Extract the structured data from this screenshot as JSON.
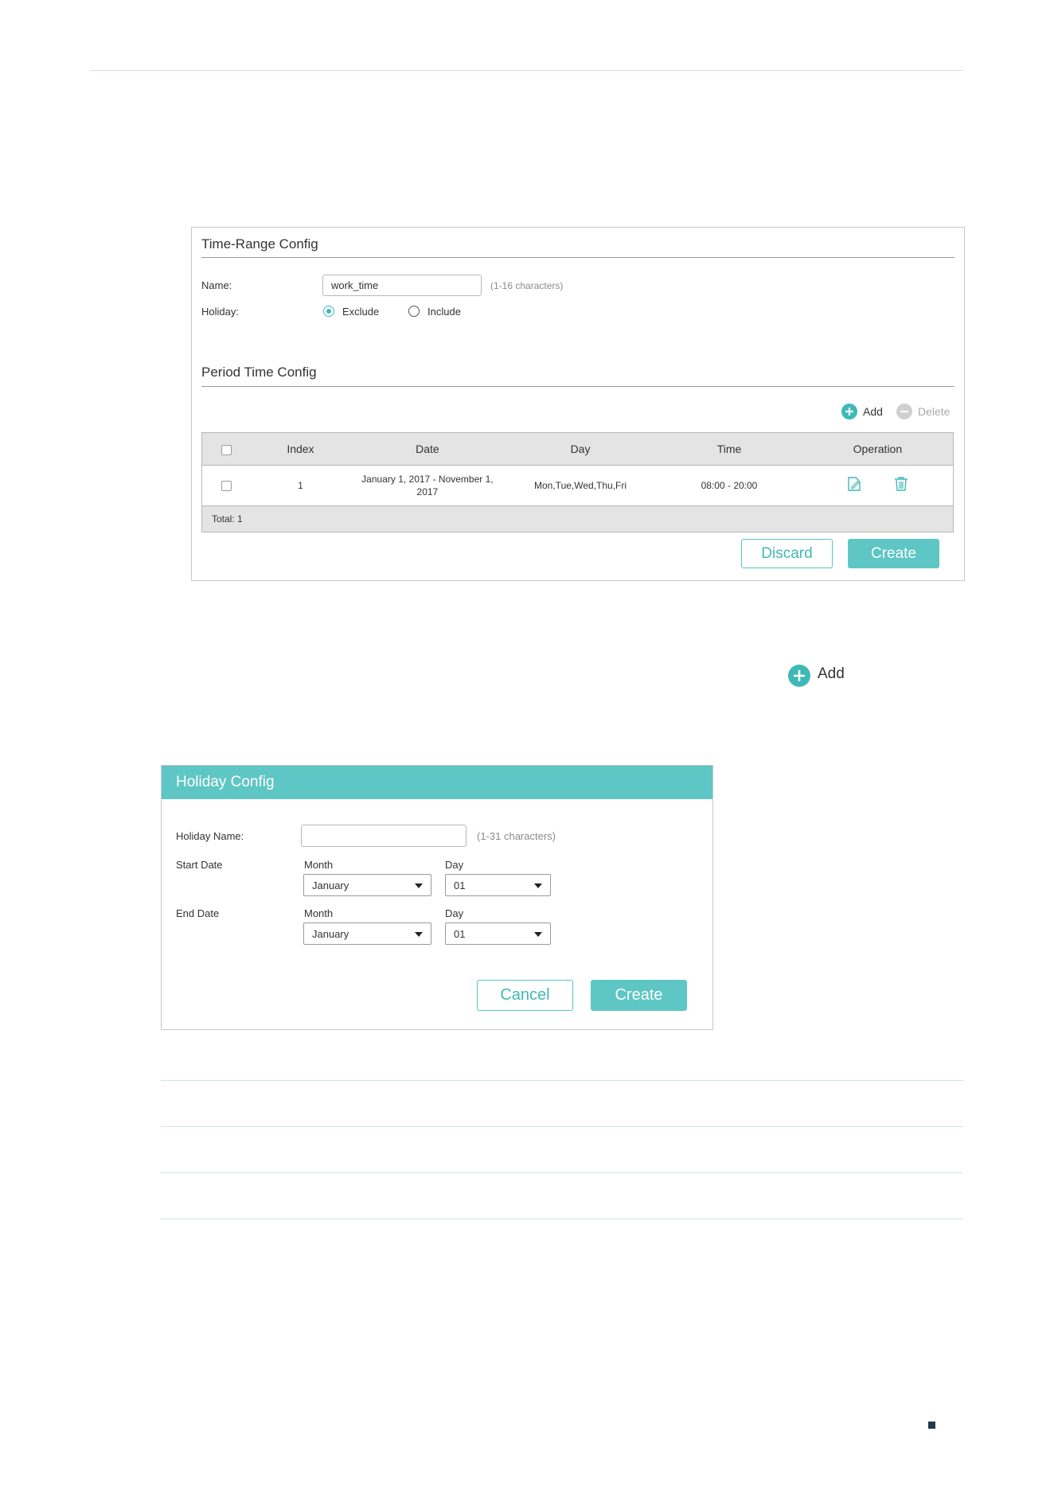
{
  "time_range_config": {
    "section_title": "Time-Range Config",
    "name_label": "Name:",
    "name_value": "work_time",
    "name_hint": "(1-16 characters)",
    "holiday_label": "Holiday:",
    "holiday_options": [
      "Exclude",
      "Include"
    ],
    "holiday_selected": "Exclude"
  },
  "period_time_config": {
    "section_title": "Period Time Config",
    "add_label": "Add",
    "delete_label": "Delete",
    "columns": [
      "Index",
      "Date",
      "Day",
      "Time",
      "Operation"
    ],
    "rows": [
      {
        "index": "1",
        "date_line1": "January 1, 2017 - November 1,",
        "date_line2": "2017",
        "day": "Mon,Tue,Wed,Thu,Fri",
        "time": "08:00 - 20:00"
      }
    ],
    "total": "Total: 1",
    "discard_label": "Discard",
    "create_label": "Create"
  },
  "add_callout": {
    "label": "Add"
  },
  "holiday_config": {
    "title": "Holiday Config",
    "holiday_name_label": "Holiday Name:",
    "holiday_name_value": "",
    "holiday_name_hint": "(1-31 characters)",
    "start_date_label": "Start Date",
    "end_date_label": "End Date",
    "month_label": "Month",
    "day_label": "Day",
    "start_month": "January",
    "start_day": "01",
    "end_month": "January",
    "end_day": "01",
    "cancel_label": "Cancel",
    "create_label": "Create"
  },
  "colors": {
    "accent": "#5ec6c4",
    "table_header_bg": "#e4e4e4",
    "rule": "#cfe3e8"
  }
}
